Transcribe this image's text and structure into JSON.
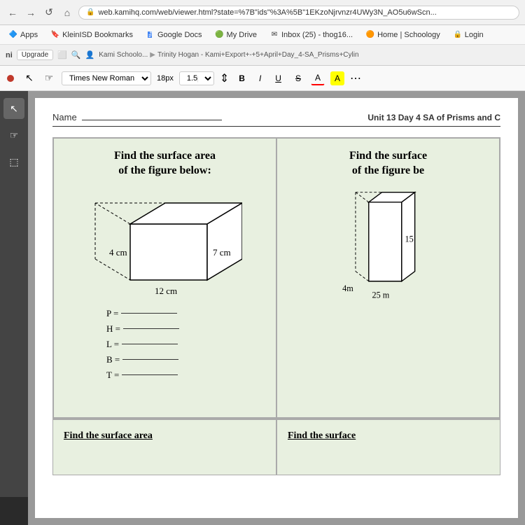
{
  "browser": {
    "url": "web.kamihq.com/web/viewer.html?state=%7B\"ids\"%3A%5B\"1EKzoNjrvnzr4UWy3N_AO5u6wScn...",
    "nav_buttons": [
      "←",
      "→",
      "↺",
      "⌂"
    ],
    "bookmarks": [
      {
        "label": "Apps",
        "icon": "🔷"
      },
      {
        "label": "KleinISD Bookmarks",
        "icon": "🔖"
      },
      {
        "label": "Google Docs",
        "icon": "📄"
      },
      {
        "label": "My Drive",
        "icon": "🟢"
      },
      {
        "label": "Inbox (25) - thog16...",
        "icon": "✉"
      },
      {
        "label": "Home | Schoology",
        "icon": "🟠"
      },
      {
        "label": "Login",
        "icon": "🔒"
      }
    ]
  },
  "kami": {
    "logo": "ni",
    "upgrade_label": "Upgrade",
    "breadcrumb_org": "Kami Schoolo...",
    "breadcrumb_file": "Trinity Hogan - Kami+Export+-+5+April+Day_4-SA_Prisms+Cylin"
  },
  "toolbar": {
    "font_name": "Times New Roman",
    "font_size": "18px",
    "size_label": "1.5pt",
    "bold": "B",
    "italic": "I",
    "underline": "U",
    "strikethrough": "S",
    "font_color": "A",
    "highlight": "A"
  },
  "document": {
    "name_label": "Name",
    "unit_title": "Unit 13 Day 4  SA of Prisms and C",
    "problem1": {
      "title": "Find the surface area\nof the figure below:",
      "dim1": "4 cm",
      "dim2": "7 cm",
      "dim3": "12 cm",
      "measurements": [
        {
          "label": "P ="
        },
        {
          "label": "H ="
        },
        {
          "label": "L ="
        },
        {
          "label": "B ="
        },
        {
          "label": "T ="
        }
      ]
    },
    "problem2": {
      "title": "Find the surface\nof the figure be",
      "dim1": "15",
      "dim2": "4m",
      "dim3": "25 m"
    },
    "bottom_problem1": {
      "title": "Find the surface area"
    },
    "bottom_problem2": {
      "title": "Find the surface"
    }
  }
}
